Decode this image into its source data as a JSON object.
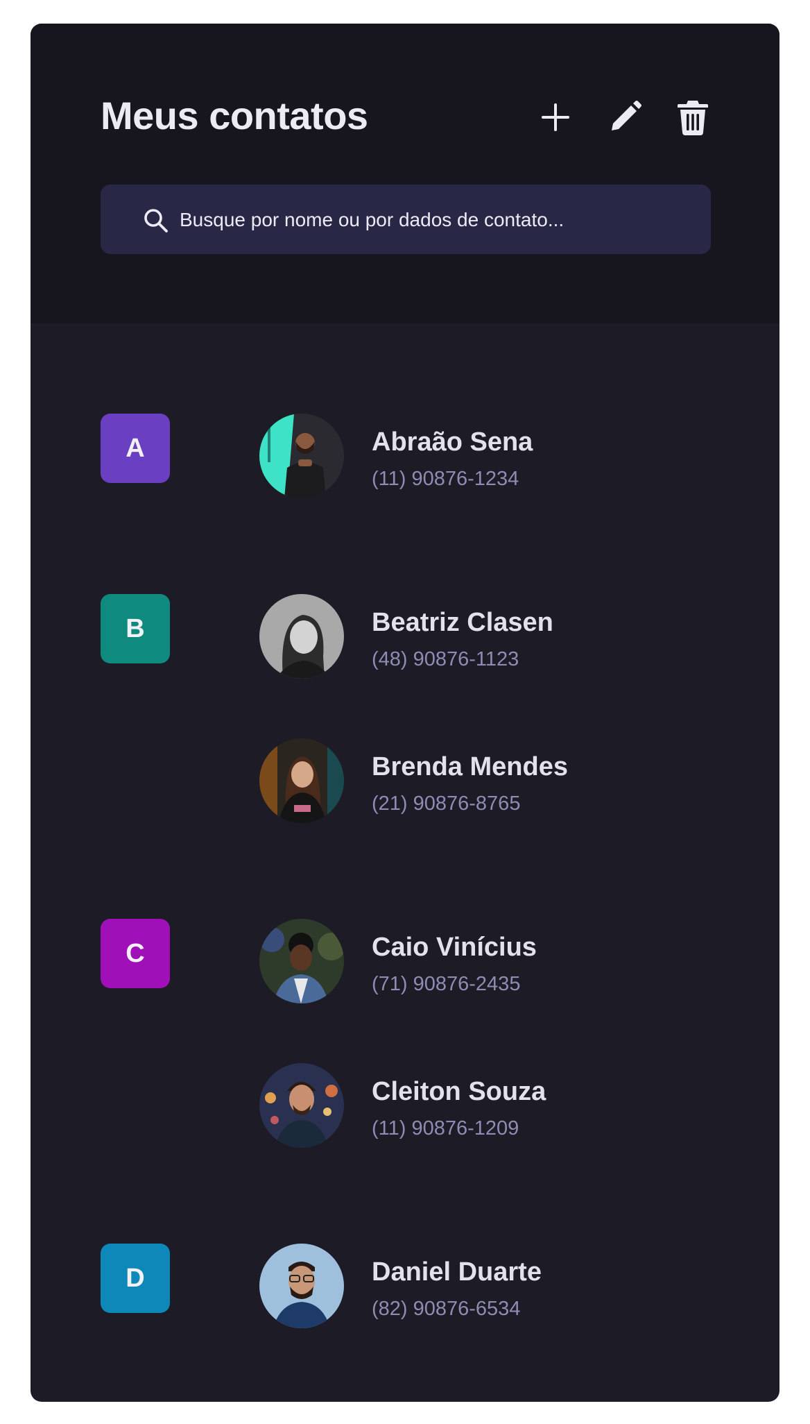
{
  "header": {
    "title": "Meus contatos",
    "actions": [
      {
        "icon": "plus-icon",
        "label": "Adicionar"
      },
      {
        "icon": "pencil-icon",
        "label": "Editar"
      },
      {
        "icon": "trash-icon",
        "label": "Excluir"
      }
    ]
  },
  "search": {
    "placeholder": "Busque por nome ou por dados de contato...",
    "icon": "search-icon"
  },
  "groups": [
    {
      "letter": "A",
      "color": "#6a3fc1",
      "contacts": [
        {
          "name": "Abraão Sena",
          "phone": "(11) 90876-1234"
        }
      ]
    },
    {
      "letter": "B",
      "color": "#0e8a7f",
      "contacts": [
        {
          "name": "Beatriz Clasen",
          "phone": "(48) 90876-1123"
        },
        {
          "name": "Brenda Mendes",
          "phone": "(21) 90876-8765"
        }
      ]
    },
    {
      "letter": "C",
      "color": "#a010b9",
      "contacts": [
        {
          "name": "Caio Vinícius",
          "phone": "(71) 90876-2435"
        },
        {
          "name": "Cleiton Souza",
          "phone": "(11) 90876-1209"
        }
      ]
    },
    {
      "letter": "D",
      "color": "#0d88b8",
      "contacts": [
        {
          "name": "Daniel Duarte",
          "phone": "(82) 90876-6534"
        }
      ]
    }
  ],
  "colors": {
    "card_bg": "#1c1b26",
    "header_bg": "#17161e",
    "search_bg": "#282846",
    "phone_text": "#8f8cb4"
  }
}
